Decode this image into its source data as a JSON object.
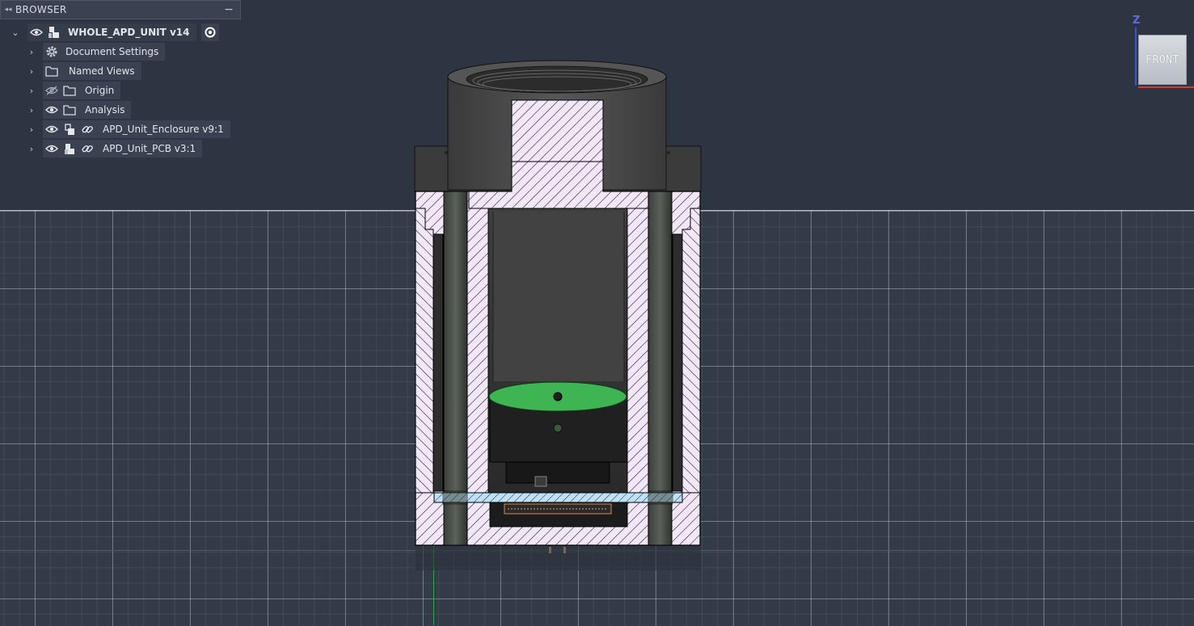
{
  "browser": {
    "title": "BROWSER",
    "minimize_glyph": "−",
    "collapse_glyph": "◂◂",
    "root": {
      "label": "WHOLE_APD_UNIT v14",
      "expanded": true
    },
    "items": [
      {
        "label": "Document Settings",
        "icon": "gear-icon"
      },
      {
        "label": "Named Views",
        "icon": "folder-icon"
      },
      {
        "label": "Origin",
        "icon": "folder-icon",
        "visible": false
      },
      {
        "label": "Analysis",
        "icon": "folder-icon",
        "visible": true
      },
      {
        "label": "APD_Unit_Enclosure v9:1",
        "icon": "component-icon",
        "linked": true,
        "visible": true
      },
      {
        "label": "APD_Unit_PCB v3:1",
        "icon": "component-icon",
        "linked": true,
        "visible": true
      }
    ]
  },
  "viewcube": {
    "face_label": "FRONT",
    "axis_label": "Z"
  },
  "colors": {
    "background": "#2e3542",
    "section_hatch_fill": "#f1e7f6",
    "pcb_hatch_fill": "#bfe0f5",
    "lens_green": "#3fb452",
    "body_dark": "#3a3a3a",
    "x_axis": "#a33b3b",
    "y_axis": "#2fa84a"
  }
}
